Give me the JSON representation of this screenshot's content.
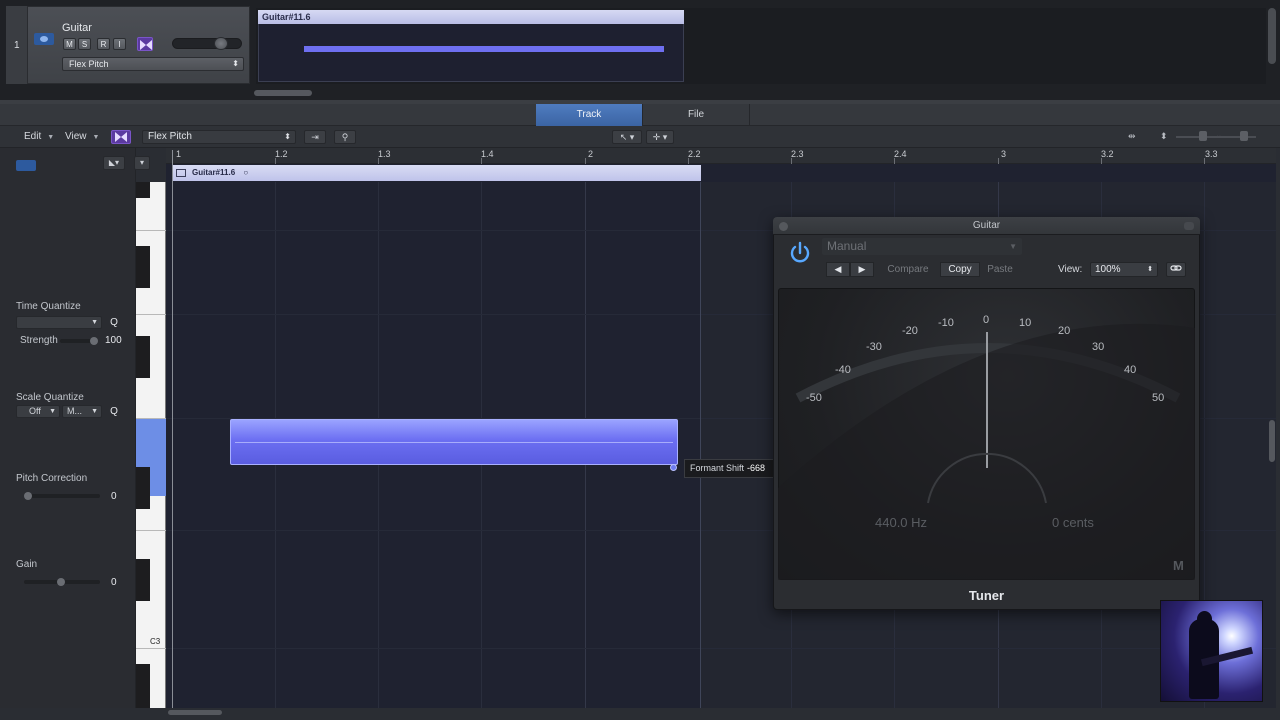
{
  "track": {
    "number": "1",
    "name": "Guitar",
    "buttons": [
      "M",
      "S",
      "R",
      "I"
    ],
    "flex_mode": "Flex Pitch"
  },
  "arrange": {
    "region_name": "Guitar#11.6"
  },
  "editor_tabs": [
    "Track",
    "File"
  ],
  "editor_toolbar": {
    "edit": "Edit",
    "view": "View",
    "flex_mode": "Flex Pitch"
  },
  "inspector": {
    "time_quantize_label": "Time Quantize",
    "q": "Q",
    "strength_label": "Strength",
    "strength_value": "100",
    "scale_quantize_label": "Scale Quantize",
    "scale_off": "Off",
    "scale_mode": "M...",
    "pitch_correction_label": "Pitch Correction",
    "pitch_correction_value": "0",
    "gain_label": "Gain",
    "gain_value": "0"
  },
  "keyboard": {
    "c3_label": "C3"
  },
  "ruler": [
    "1",
    "1.2",
    "1.3",
    "1.4",
    "2",
    "2.2",
    "2.3",
    "2.4",
    "3",
    "3.2",
    "3.3"
  ],
  "region": {
    "name": "Guitar#11.6"
  },
  "formant_tooltip": {
    "label": "Formant Shift",
    "value": "-668"
  },
  "tuner": {
    "window_title": "Guitar",
    "preset": "Manual",
    "compare": "Compare",
    "copy": "Copy",
    "paste": "Paste",
    "view_label": "View:",
    "view_value": "100%",
    "scale": [
      "-50",
      "-40",
      "-30",
      "-20",
      "-10",
      "0",
      "10",
      "20",
      "30",
      "40",
      "50"
    ],
    "hz_readout": "440.0 Hz",
    "cents_readout": "0 cents",
    "badge": "M",
    "plugin_name": "Tuner"
  },
  "colors": {
    "accent_blue": "#4f7cc0",
    "flex_purple": "#5b3aa0",
    "note_blue": "#6c6ff2",
    "power_blue": "#58a8ff"
  },
  "icons": {
    "power": "power-icon",
    "link": "link-icon",
    "prev": "prev-icon",
    "next": "next-icon"
  }
}
